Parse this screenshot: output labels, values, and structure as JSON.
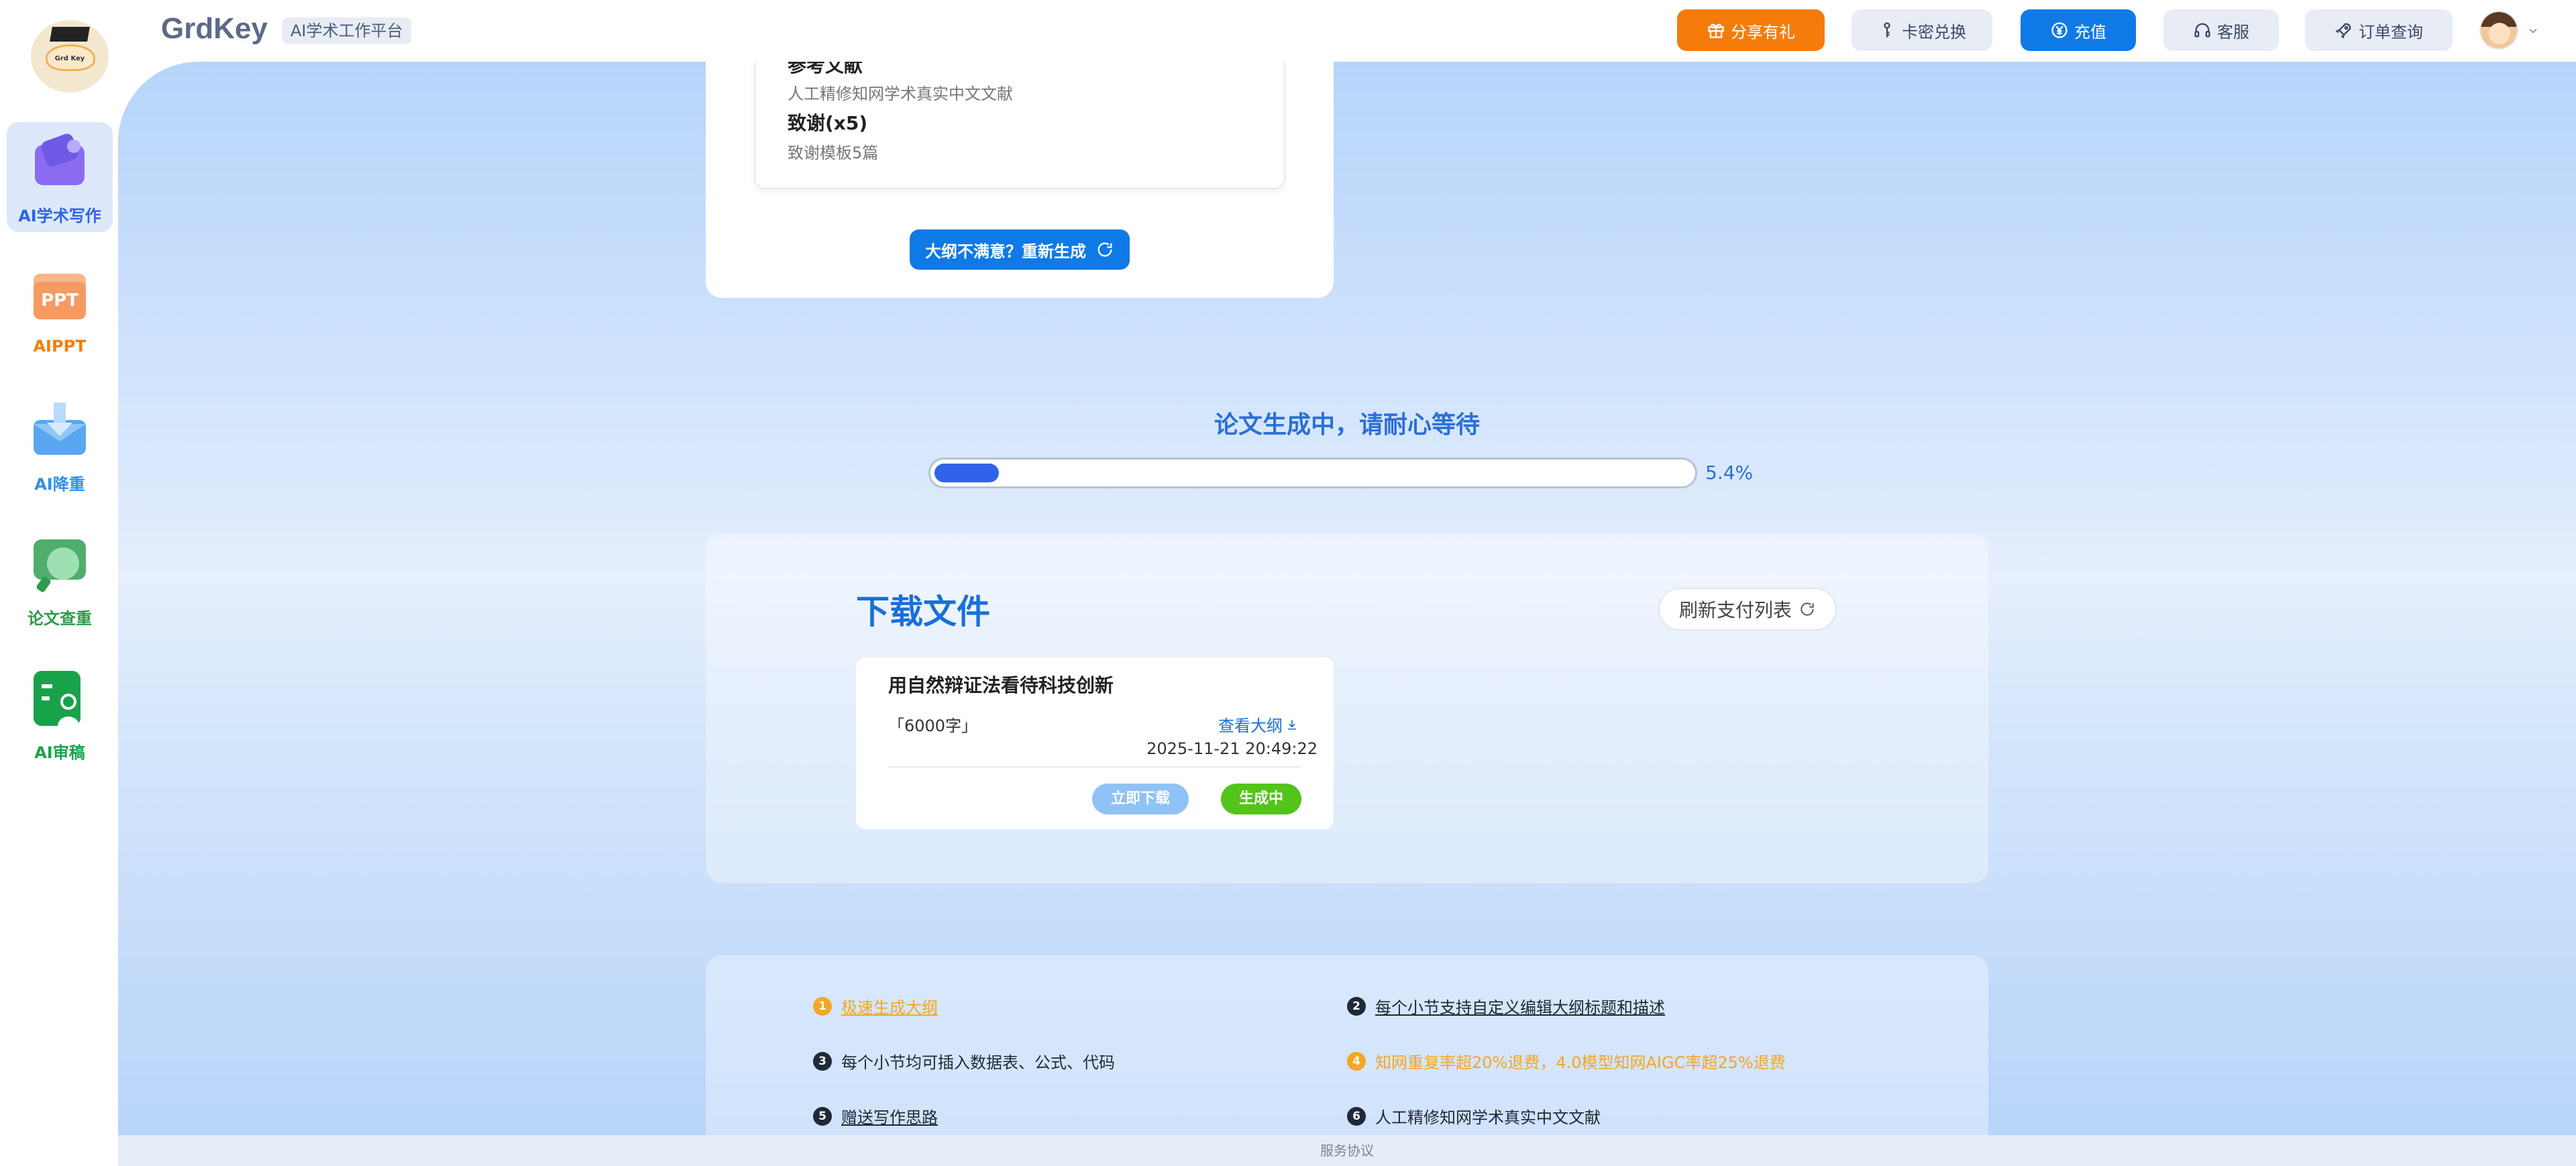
{
  "header": {
    "logo_text": "Grd Key",
    "brand": "GrdKey",
    "tag": "AI学术工作平台",
    "share": "分享有礼",
    "card": "卡密兑换",
    "recharge": "充值",
    "service": "客服",
    "orders": "订单查询"
  },
  "sidebar": {
    "items": [
      {
        "label": "AI学术写作",
        "color": "#2f63e8"
      },
      {
        "label": "AIPPT",
        "color": "#f57c0a"
      },
      {
        "label": "AI降重",
        "color": "#2f8fe8"
      },
      {
        "label": "论文查重",
        "color": "#2e9a4a"
      },
      {
        "label": "AI审稿",
        "color": "#18a34a"
      }
    ]
  },
  "outline": {
    "ref_title": "参考文献",
    "ref_desc": "人工精修知网学术真实中文文献",
    "ack_title": "致谢(x5)",
    "ack_desc": "致谢模板5篇",
    "regen": "大纲不满意？重新生成"
  },
  "progress": {
    "title": "论文生成中，请耐心等待",
    "value": 5.4,
    "label": "5.4%"
  },
  "download": {
    "title": "下载文件",
    "refresh": "刷新支付列表",
    "file": {
      "title": "用自然辩证法看待科技创新",
      "words": "「6000字」",
      "view": "查看大纲",
      "time": "2025-11-21 20:49:22",
      "download": "立即下载",
      "status": "生成中"
    }
  },
  "features": [
    {
      "num": "1",
      "text": "极速生成大纲",
      "style": "org",
      "underline": true
    },
    {
      "num": "2",
      "text": "每个小节支持自定义编辑大纲标题和描述",
      "style": "dark",
      "underline": true
    },
    {
      "num": "3",
      "text": "每个小节均可插入数据表、公式、代码",
      "style": "dark",
      "underline": false
    },
    {
      "num": "4",
      "text": "知网重复率超20%退费，4.0模型知网AIGC率超25%退费",
      "style": "org",
      "underline": false
    },
    {
      "num": "5",
      "text": "赠送写作思路",
      "style": "dark",
      "underline": true
    },
    {
      "num": "6",
      "text": "人工精修知网学术真实中文文献",
      "style": "dark",
      "underline": false
    }
  ],
  "footer": "服务协议"
}
